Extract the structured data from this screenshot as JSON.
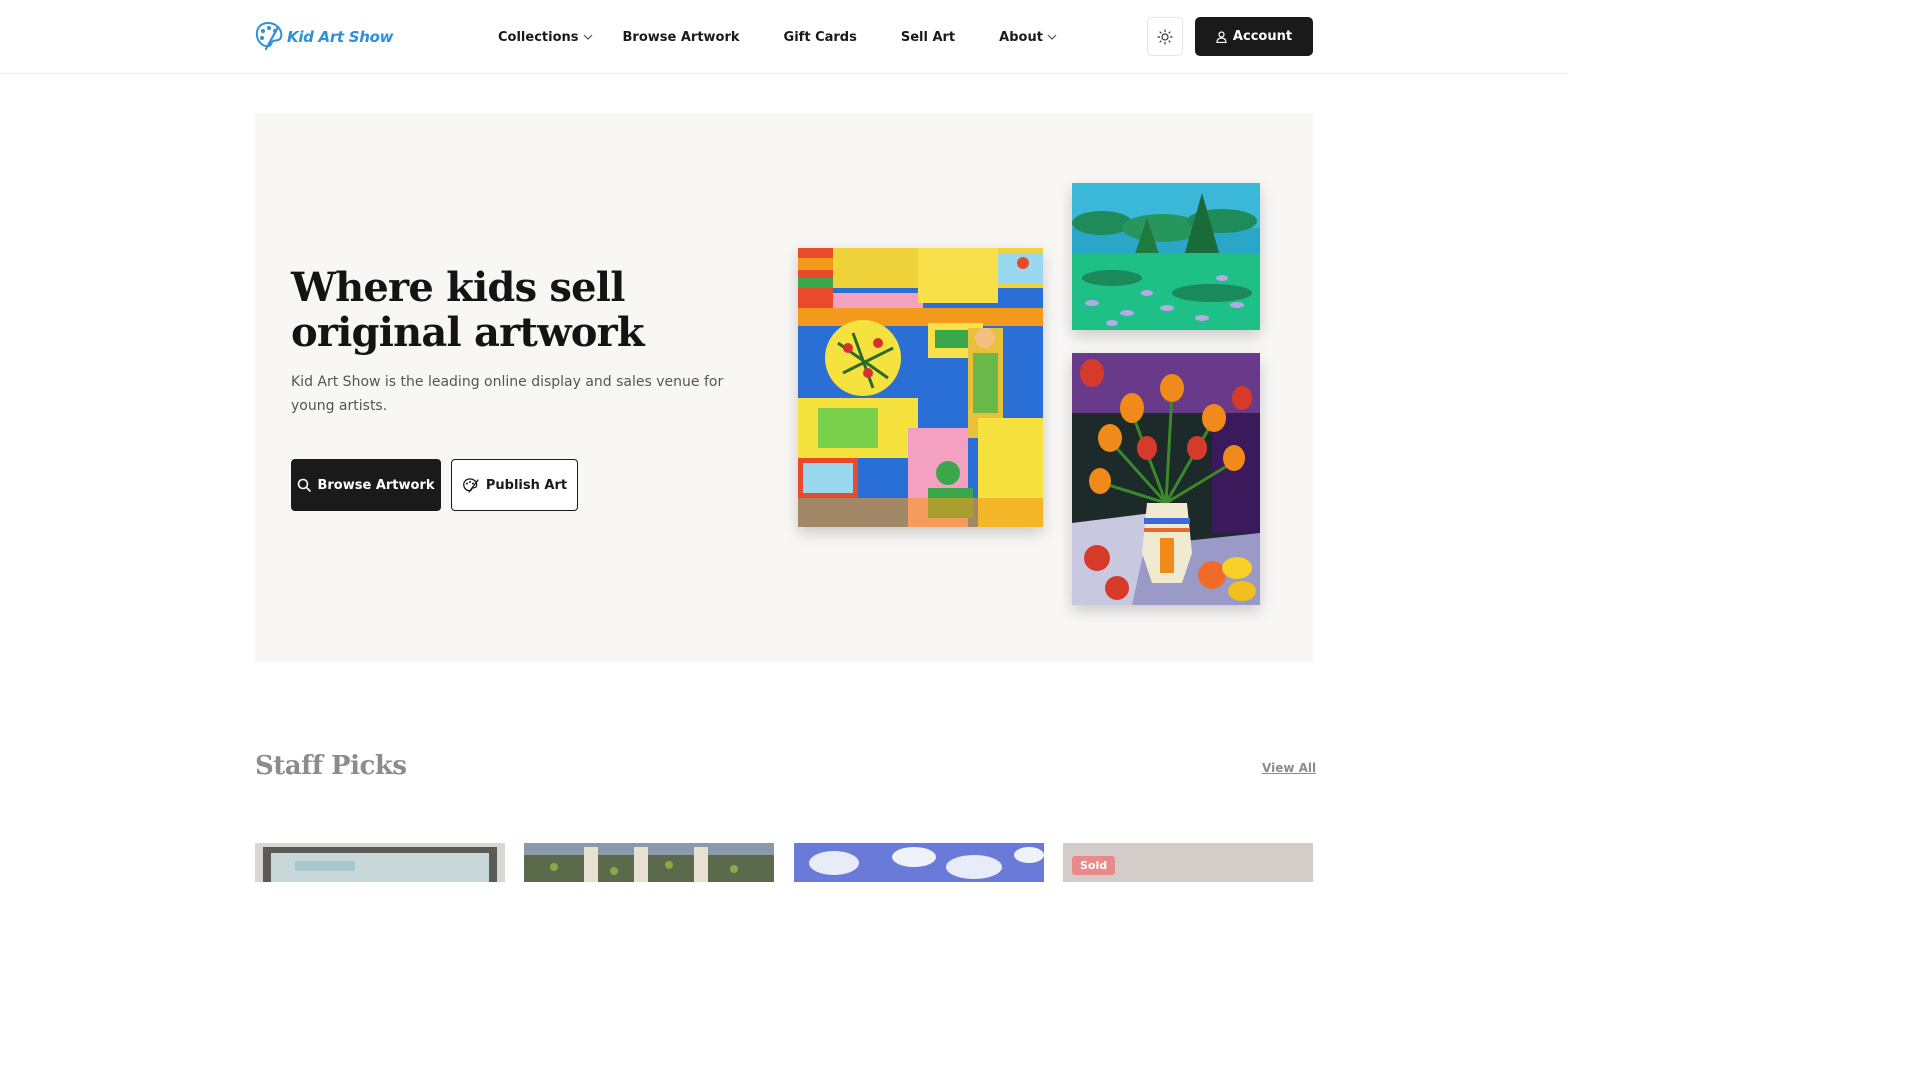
{
  "header": {
    "logo_text": "Kid Art Show",
    "nav": [
      {
        "label": "Collections",
        "has_dropdown": true
      },
      {
        "label": "Browse Artwork",
        "has_dropdown": false
      },
      {
        "label": "Gift Cards",
        "has_dropdown": false
      },
      {
        "label": "Sell Art",
        "has_dropdown": false
      },
      {
        "label": "About",
        "has_dropdown": true
      }
    ],
    "theme_icon": "sun-icon",
    "account_label": "Account",
    "account_icon": "user-icon"
  },
  "hero": {
    "title": "Where kids sell original artwork",
    "subtitle": "Kid Art Show is the leading online display and sales venue for young artists.",
    "primary_button": "Browse Artwork",
    "primary_icon": "search-icon",
    "secondary_button": "Publish Art",
    "secondary_icon": "palette-icon",
    "artworks": [
      "town-scene-painting",
      "forest-landscape-painting",
      "tulips-vase-painting"
    ]
  },
  "staff_picks": {
    "title": "Staff Picks",
    "view_all": "View All",
    "cards": [
      {
        "badge": ""
      },
      {
        "badge": ""
      },
      {
        "badge": ""
      },
      {
        "badge": "Sold"
      }
    ]
  },
  "colors": {
    "brand": "#2f8fd8",
    "dark": "#1a1a1a",
    "hero_bg": "#f8f7f5",
    "sold": "#e88a8a"
  }
}
